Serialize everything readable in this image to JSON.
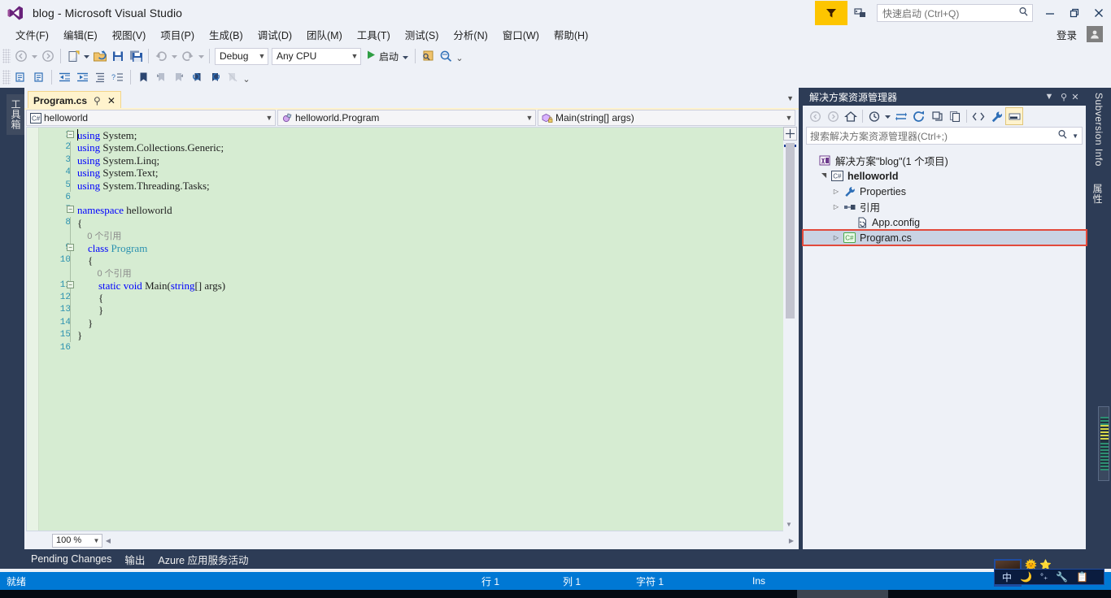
{
  "titlebar": {
    "title": "blog - Microsoft Visual Studio",
    "logo_icon": "visual-studio-logo-icon",
    "feedback_icon": "feedback-funnel-icon",
    "notify_icon": "notifications-icon",
    "search_icon": "search-icon",
    "quick_launch_placeholder": "快速启动 (Ctrl+Q)",
    "minimize": "minimize-icon",
    "maximize": "restore-icon",
    "close": "close-icon"
  },
  "menubar": {
    "items": [
      {
        "label": "文件(F)",
        "key": "F"
      },
      {
        "label": "编辑(E)",
        "key": "E"
      },
      {
        "label": "视图(V)",
        "key": "V"
      },
      {
        "label": "项目(P)",
        "key": "P"
      },
      {
        "label": "生成(B)",
        "key": "B"
      },
      {
        "label": "调试(D)",
        "key": "D"
      },
      {
        "label": "团队(M)",
        "key": "M"
      },
      {
        "label": "工具(T)",
        "key": "T"
      },
      {
        "label": "测试(S)",
        "key": "S"
      },
      {
        "label": "分析(N)",
        "key": "N"
      },
      {
        "label": "窗口(W)",
        "key": "W"
      },
      {
        "label": "帮助(H)",
        "key": "H"
      }
    ],
    "signin_label": "登录",
    "account_icon": "account-avatar-icon"
  },
  "toolbar": {
    "row1": {
      "nav_back_icon": "navigate-back-icon",
      "nav_forward_icon": "navigate-forward-icon",
      "new_project_icon": "new-project-icon",
      "open_file_icon": "open-file-icon",
      "save_icon": "save-icon",
      "save_all_icon": "save-all-icon",
      "undo_icon": "undo-icon",
      "redo_icon": "redo-icon",
      "config_value": "Debug",
      "platform_value": "Any CPU",
      "start_label": "启动",
      "start_icon": "play-icon",
      "attach_icon": "attach-to-process-icon",
      "find_icon": "find-in-files-icon",
      "overflow_icon": "toolbar-overflow-icon"
    },
    "row2": {
      "comment_icon": "comment-selection-icon",
      "uncomment_icon": "uncomment-selection-icon",
      "outdent_icon": "decrease-indent-icon",
      "indent_icon": "increase-indent-icon",
      "format_icon": "format-document-icon",
      "format_sel_icon": "format-selection-icon",
      "bookmark_icon": "toggle-bookmark-icon",
      "prev_bookmark_icon": "previous-bookmark-icon",
      "next_bookmark_icon": "next-bookmark-icon",
      "prev_bookmark_folder_icon": "previous-bookmark-in-folder-icon",
      "next_bookmark_folder_icon": "next-bookmark-in-folder-icon",
      "clear_bookmarks_icon": "clear-bookmarks-icon",
      "overflow_icon": "toolbar-overflow-icon"
    }
  },
  "left_dock": {
    "toolbox_tab": "工具箱"
  },
  "right_dock": {
    "subversion_tab": "Subversion Info",
    "properties_tab": "属性"
  },
  "editor": {
    "tab": {
      "name": "Program.cs",
      "pin_icon": "pin-icon",
      "close_icon": "close-icon"
    },
    "tabstrip_caret_icon": "chevron-down-icon",
    "navbar": {
      "project_icon": "csharp-project-icon",
      "project_value": "helloworld",
      "type_icon": "class-icon",
      "type_value": "helloworld.Program",
      "member_icon": "method-private-icon",
      "member_value": "Main(string[] args)"
    },
    "zoom_value": "100 %",
    "split_icon": "split-editor-icon",
    "scroll_up_icon": "scroll-up-icon",
    "scroll_down_icon": "scroll-down-icon",
    "code": [
      {
        "no": "1",
        "fold": "minus",
        "tokens": [
          {
            "t": "using",
            "c": "kw"
          },
          {
            "t": " System;",
            "c": "pl"
          }
        ]
      },
      {
        "no": "2",
        "vline": true,
        "tokens": [
          {
            "t": "using",
            "c": "kw"
          },
          {
            "t": " System.Collections.Generic;",
            "c": "pl"
          }
        ]
      },
      {
        "no": "3",
        "vline": true,
        "tokens": [
          {
            "t": "using",
            "c": "kw"
          },
          {
            "t": " System.Linq;",
            "c": "pl"
          }
        ]
      },
      {
        "no": "4",
        "vline": true,
        "tokens": [
          {
            "t": "using",
            "c": "kw"
          },
          {
            "t": " System.Text;",
            "c": "pl"
          }
        ]
      },
      {
        "no": "5",
        "vline": true,
        "tokens": [
          {
            "t": "using",
            "c": "kw"
          },
          {
            "t": " System.Threading.Tasks;",
            "c": "pl"
          }
        ]
      },
      {
        "no": "6",
        "tokens": []
      },
      {
        "no": "7",
        "fold": "minus",
        "tokens": [
          {
            "t": "namespace",
            "c": "kw"
          },
          {
            "t": " helloworld",
            "c": "pl"
          }
        ]
      },
      {
        "no": "8",
        "vline": true,
        "tokens": [
          {
            "t": "{",
            "c": "pl"
          }
        ]
      },
      {
        "no": "",
        "vline": true,
        "tokens": [
          {
            "t": "    0 个引用",
            "c": "lens"
          }
        ]
      },
      {
        "no": "9",
        "fold": "minus",
        "vline": true,
        "tokens": [
          {
            "t": "    ",
            "c": "pl"
          },
          {
            "t": "class",
            "c": "kw"
          },
          {
            "t": " ",
            "c": "pl"
          },
          {
            "t": "Program",
            "c": "ty"
          }
        ]
      },
      {
        "no": "10",
        "vline": true,
        "tokens": [
          {
            "t": "    {",
            "c": "pl"
          }
        ]
      },
      {
        "no": "",
        "vline": true,
        "tokens": [
          {
            "t": "        0 个引用",
            "c": "lens"
          }
        ]
      },
      {
        "no": "11",
        "fold": "minus",
        "vline": true,
        "tokens": [
          {
            "t": "        ",
            "c": "pl"
          },
          {
            "t": "static",
            "c": "kw"
          },
          {
            "t": " ",
            "c": "pl"
          },
          {
            "t": "void",
            "c": "kw"
          },
          {
            "t": " Main(",
            "c": "pl"
          },
          {
            "t": "string",
            "c": "kw"
          },
          {
            "t": "[] args)",
            "c": "pl"
          }
        ]
      },
      {
        "no": "12",
        "vline": true,
        "tokens": [
          {
            "t": "        {",
            "c": "pl"
          }
        ]
      },
      {
        "no": "13",
        "vline": true,
        "tokens": [
          {
            "t": "        }",
            "c": "pl"
          }
        ]
      },
      {
        "no": "14",
        "vline": true,
        "tokens": [
          {
            "t": "    }",
            "c": "pl"
          }
        ]
      },
      {
        "no": "15",
        "vline": true,
        "tokens": [
          {
            "t": "}",
            "c": "pl"
          }
        ]
      },
      {
        "no": "16",
        "tokens": []
      }
    ]
  },
  "solution_explorer": {
    "title": "解决方案资源管理器",
    "dropdown_icon": "chevron-down-icon",
    "pin_icon": "pin-icon",
    "close_icon": "close-icon",
    "toolbar_icons": [
      "back-icon",
      "forward-icon",
      "home-icon",
      "pending-changes-icon",
      "chevron-down-icon",
      "sync-with-active-document-icon",
      "refresh-icon",
      "collapse-all-icon",
      "show-all-files-icon",
      "view-code-icon",
      "properties-wrench-icon",
      "preview-selected-items-icon"
    ],
    "search_placeholder": "搜索解决方案资源管理器(Ctrl+;)",
    "search_icon": "search-icon",
    "search_caret_icon": "chevron-down-icon",
    "tree": [
      {
        "label": "解决方案\"blog\"(1 个项目)",
        "icon": "solution-icon",
        "indent": 0,
        "expander": "",
        "bold": false,
        "selected": false,
        "highlighted": false
      },
      {
        "label": "helloworld",
        "icon": "csharp-project-icon",
        "indent": 1,
        "expander": "▲",
        "bold": true,
        "selected": false,
        "highlighted": false
      },
      {
        "label": "Properties",
        "icon": "wrench-icon",
        "indent": 2,
        "expander": "▶",
        "bold": false,
        "selected": false,
        "highlighted": false
      },
      {
        "label": "引用",
        "icon": "references-icon",
        "indent": 2,
        "expander": "▶",
        "bold": false,
        "selected": false,
        "highlighted": false
      },
      {
        "label": "App.config",
        "icon": "config-file-icon",
        "indent": 3,
        "expander": "",
        "bold": false,
        "selected": false,
        "highlighted": false
      },
      {
        "label": "Program.cs",
        "icon": "csharp-file-icon",
        "indent": 2,
        "expander": "▶",
        "bold": false,
        "selected": true,
        "highlighted": true
      }
    ],
    "highlight_color": "#e24a3b"
  },
  "bottom_tabs": [
    {
      "label": "Pending Changes"
    },
    {
      "label": "输出"
    },
    {
      "label": "Azure 应用服务活动"
    }
  ],
  "statusbar": {
    "ready": "就绪",
    "line": "行 1",
    "column": "列 1",
    "character": "字符 1",
    "insert_mode": "Ins",
    "background": "#0078d4"
  },
  "ime": {
    "mode": "中",
    "moon_icon": "moon-icon",
    "punct_icon": "punctuation-icon",
    "tool_icon": "wrench-icon",
    "menu_icon": "ime-menu-icon",
    "badge_sun_icon": "sun-badge-icon",
    "badge_star_icon": "star-badge-icon",
    "avatar_icon": "user-avatar-icon"
  }
}
